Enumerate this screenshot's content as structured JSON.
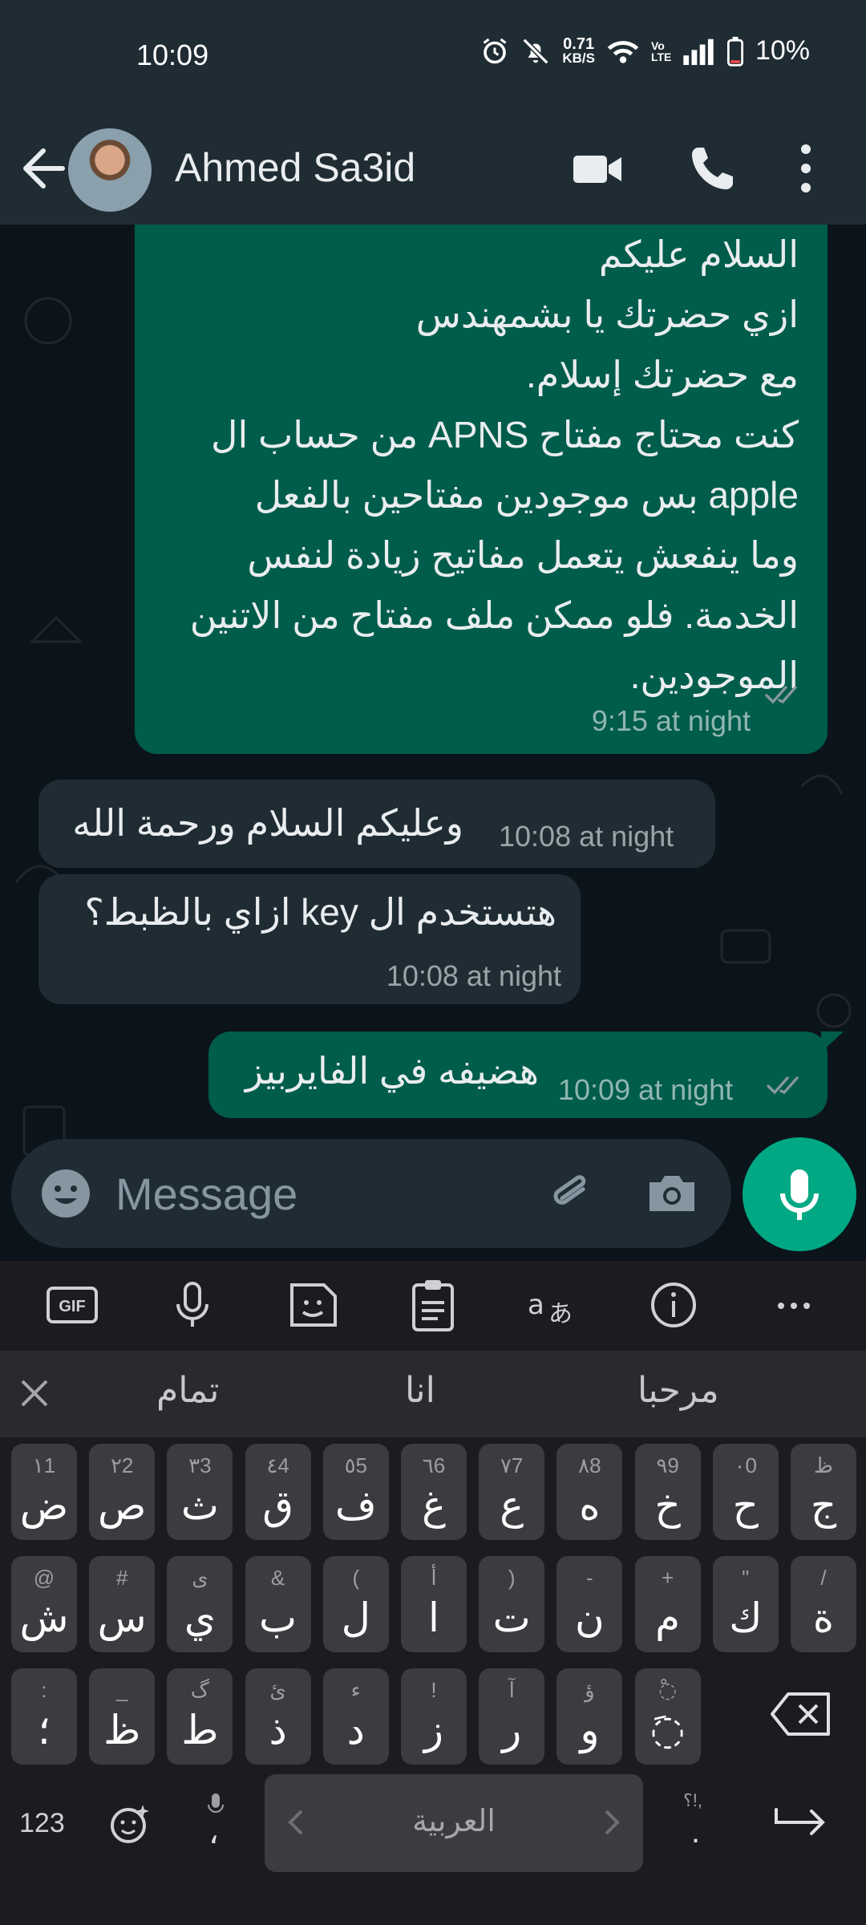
{
  "status_bar": {
    "time": "10:09",
    "net_speed_value": "0.71",
    "net_speed_unit": "KB/S",
    "volte": "Vo LTE",
    "battery": "10%"
  },
  "header": {
    "contact_name": "Ahmed Sa3id"
  },
  "messages": [
    {
      "direction": "outgoing",
      "lines": [
        "السلام عليكم",
        "ازي حضرتك يا بشمهندس",
        "مع حضرتك إسلام.",
        "كنت محتاج مفتاح APNS من حساب ال",
        "apple بس موجودين مفتاحين بالفعل",
        "وما ينفعش يتعمل مفاتيح زيادة لنفس",
        "الخدمة. فلو ممكن ملف مفتاح من الاتنين",
        "الموجودين."
      ],
      "time": "9:15 at night",
      "status": "read"
    },
    {
      "direction": "incoming",
      "lines": [
        "وعليكم السلام ورحمة الله"
      ],
      "time": "10:08 at night"
    },
    {
      "direction": "incoming",
      "lines": [
        "هتستخدم ال key ازاي بالظبط؟"
      ],
      "time": "10:08 at night"
    },
    {
      "direction": "outgoing",
      "lines": [
        "هضيفه في الفايربيز"
      ],
      "time": "10:09 at night",
      "status": "read"
    }
  ],
  "composer": {
    "placeholder": "Message"
  },
  "keyboard": {
    "suggestions": [
      "تمام",
      "انا",
      "مرحبا"
    ],
    "row1": [
      {
        "main": "ض",
        "hint": "١1"
      },
      {
        "main": "ص",
        "hint": "٢2"
      },
      {
        "main": "ث",
        "hint": "٣3"
      },
      {
        "main": "ق",
        "hint": "٤4"
      },
      {
        "main": "ف",
        "hint": "٥5"
      },
      {
        "main": "غ",
        "hint": "٦6"
      },
      {
        "main": "ع",
        "hint": "٧7"
      },
      {
        "main": "ه",
        "hint": "٨8"
      },
      {
        "main": "خ",
        "hint": "٩9"
      },
      {
        "main": "ح",
        "hint": "٠0"
      },
      {
        "main": "ج",
        "hint": "ظ"
      }
    ],
    "row2": [
      {
        "main": "ش",
        "hint": "@"
      },
      {
        "main": "س",
        "hint": "#"
      },
      {
        "main": "ي",
        "hint": "ى"
      },
      {
        "main": "ب",
        "hint": "&"
      },
      {
        "main": "ل",
        "hint": "("
      },
      {
        "main": "ا",
        "hint": "أ"
      },
      {
        "main": "ت",
        "hint": ")"
      },
      {
        "main": "ن",
        "hint": "-"
      },
      {
        "main": "م",
        "hint": "+"
      },
      {
        "main": "ك",
        "hint": "\""
      },
      {
        "main": "ة",
        "hint": "/"
      }
    ],
    "row3": [
      {
        "main": "؛",
        "hint": ":"
      },
      {
        "main": "ظ",
        "hint": "_"
      },
      {
        "main": "ط",
        "hint": "گ"
      },
      {
        "main": "ذ",
        "hint": "ئ"
      },
      {
        "main": "د",
        "hint": "ء"
      },
      {
        "main": "ز",
        "hint": "!"
      },
      {
        "main": "ر",
        "hint": "آ"
      },
      {
        "main": "و",
        "hint": "ؤ"
      },
      {
        "main": "◌َ",
        "hint": "◌ْ"
      }
    ],
    "numbers_key": "123",
    "comma_key": "،",
    "period_key": ".",
    "period_hint": "؟!,",
    "space_label": "العربية"
  },
  "colors": {
    "accent": "#00a884",
    "outgoing_bubble": "#005c4b",
    "incoming_bubble": "#1f2c34",
    "header_bg": "#1f2c34",
    "chat_bg": "#0b141a"
  }
}
